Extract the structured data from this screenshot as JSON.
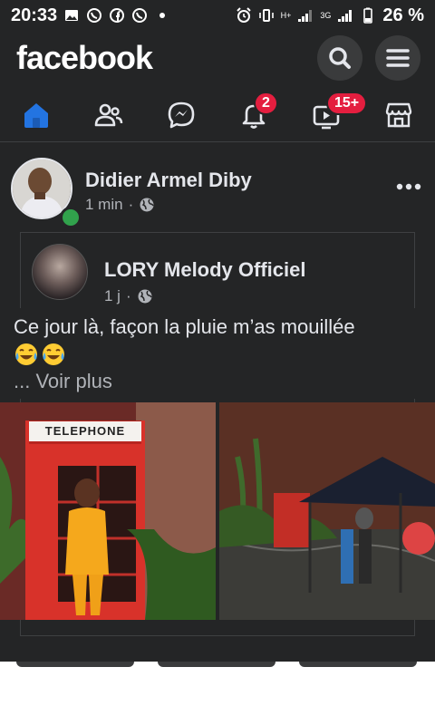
{
  "status_bar": {
    "time": "20:33",
    "network_small": "H+",
    "network_3g": "3G",
    "battery": "26 %"
  },
  "header": {
    "logo": "facebook",
    "search_icon": "search-icon",
    "menu_icon": "menu-icon"
  },
  "nav": {
    "items": [
      {
        "name": "home",
        "icon": "home-icon",
        "active": true
      },
      {
        "name": "friends",
        "icon": "friends-icon"
      },
      {
        "name": "messenger",
        "icon": "messenger-icon"
      },
      {
        "name": "notifications",
        "icon": "bell-icon",
        "badge": "2"
      },
      {
        "name": "watch",
        "icon": "video-icon",
        "badge": "15+"
      },
      {
        "name": "marketplace",
        "icon": "store-icon"
      }
    ],
    "active_color": "#2374e1"
  },
  "post": {
    "author": "Didier Armel Diby",
    "time": "1 min",
    "separator": "·",
    "shared": {
      "author": "LORY Melody Officiel",
      "time": "1 j",
      "separator": "·"
    },
    "text": "Ce jour là, façon la pluie m’as mouillée",
    "emojis": [
      "laugh-cry-emoji",
      "laugh-cry-emoji"
    ],
    "see_more": "... Voir plus",
    "photo_sign": "TELEPHONE"
  },
  "colors": {
    "background": "#242526",
    "badge": "#e41e3f",
    "online": "#31a24c"
  }
}
